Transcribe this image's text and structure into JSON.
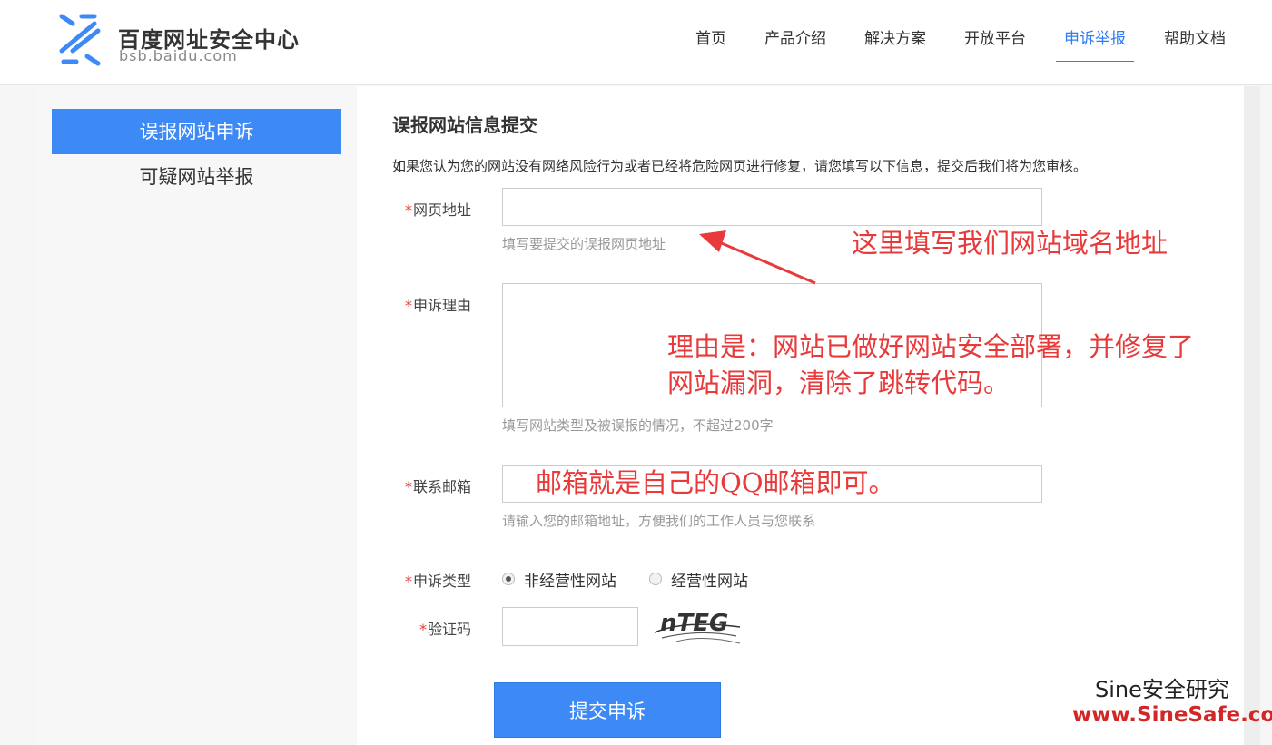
{
  "header": {
    "logo_title": "百度网址安全中心",
    "logo_subtitle": "bsb.baidu.com",
    "nav": [
      {
        "label": "首页",
        "active": false
      },
      {
        "label": "产品介绍",
        "active": false
      },
      {
        "label": "解决方案",
        "active": false
      },
      {
        "label": "开放平台",
        "active": false
      },
      {
        "label": "申诉举报",
        "active": true
      },
      {
        "label": "帮助文档",
        "active": false
      }
    ]
  },
  "sidebar": {
    "items": [
      {
        "label": "误报网站申诉",
        "active": true
      },
      {
        "label": "可疑网站举报",
        "active": false
      }
    ]
  },
  "form": {
    "title": "误报网站信息提交",
    "description": "如果您认为您的网站没有网络风险行为或者已经将危险网页进行修复，请您填写以下信息，提交后我们将为您审核。",
    "required_mark": "*",
    "url": {
      "label": "网页地址",
      "value": "",
      "hint": "填写要提交的误报网页地址"
    },
    "reason": {
      "label": "申诉理由",
      "value": "",
      "hint": "填写网站类型及被误报的情况，不超过200字"
    },
    "email": {
      "label": "联系邮箱",
      "value": "",
      "hint": "请输入您的邮箱地址，方便我们的工作人员与您联系"
    },
    "type": {
      "label": "申诉类型",
      "options": [
        {
          "label": "非经营性网站",
          "checked": true
        },
        {
          "label": "经营性网站",
          "checked": false
        }
      ]
    },
    "captcha": {
      "label": "验证码",
      "value": "",
      "image_text": "nTEG"
    },
    "submit_label": "提交申诉"
  },
  "annotations": {
    "url_note": "这里填写我们网站域名地址",
    "reason_note_line1": "理由是：网站已做好网站安全部署，并修复了",
    "reason_note_line2": "网站漏洞，清除了跳转代码。",
    "email_note": "邮箱就是自己的QQ邮箱即可。"
  },
  "watermark": {
    "line1": "Sine安全研究",
    "line2": "www.SineSafe.com"
  },
  "colors": {
    "accent": "#3d8af7",
    "nav_active": "#2e7cf6",
    "annotation": "#e83a3a",
    "required": "#e53935"
  }
}
